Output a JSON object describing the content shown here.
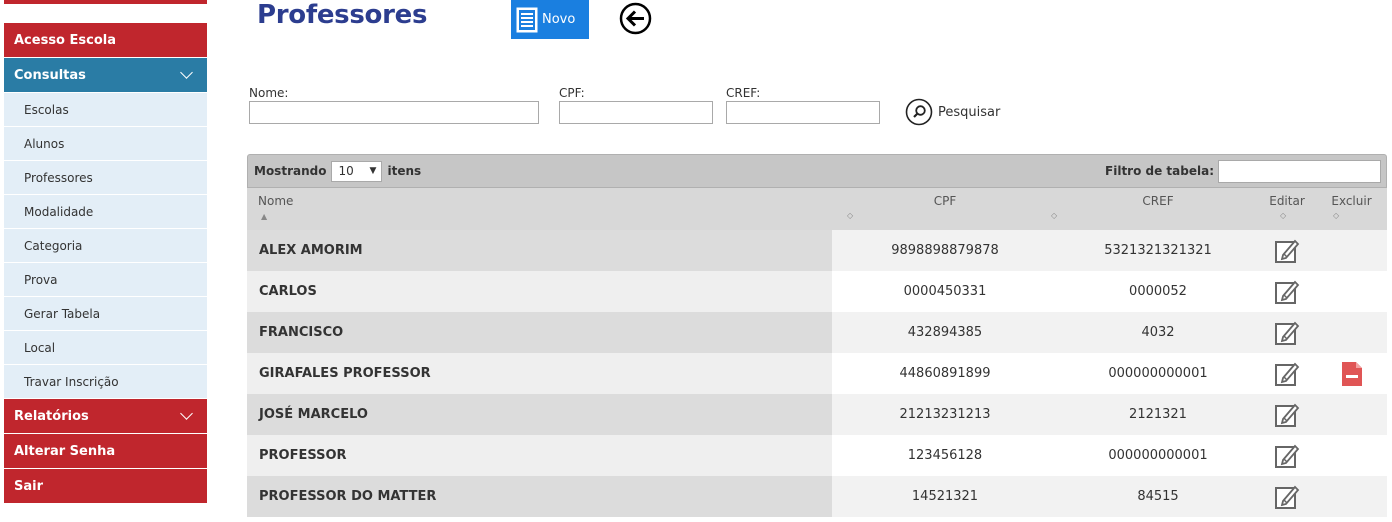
{
  "sidebar": {
    "items": [
      {
        "label": "Acesso Escola",
        "type": "red"
      },
      {
        "label": "Consultas",
        "type": "blue",
        "expanded": true
      },
      {
        "label": "Relatórios",
        "type": "red"
      },
      {
        "label": "Alterar Senha",
        "type": "red"
      },
      {
        "label": "Sair",
        "type": "red"
      }
    ],
    "consultas_sub": [
      "Escolas",
      "Alunos",
      "Professores",
      "Modalidade",
      "Categoria",
      "Prova",
      "Gerar Tabela",
      "Local",
      "Travar Inscrição"
    ]
  },
  "header": {
    "title": "Professores",
    "novo_label": "Novo",
    "back_icon": "arrow-left-circle-icon"
  },
  "filters": {
    "nome_label": "Nome:",
    "cpf_label": "CPF:",
    "cref_label": "CREF:",
    "nome_value": "",
    "cpf_value": "",
    "cref_value": "",
    "search_label": "Pesquisar"
  },
  "table": {
    "showing_label": "Mostrando",
    "page_size": "10",
    "items_label": "itens",
    "filter_label": "Filtro de tabela:",
    "filter_value": "",
    "columns": [
      "Nome",
      "CPF",
      "CREF",
      "Editar",
      "Excluir"
    ],
    "rows": [
      {
        "nome": "ALEX AMORIM",
        "cpf": "9898898879878",
        "cref": "5321321321321",
        "deletable": false
      },
      {
        "nome": "CARLOS",
        "cpf": "0000450331",
        "cref": "0000052",
        "deletable": false
      },
      {
        "nome": "FRANCISCO",
        "cpf": "432894385",
        "cref": "4032",
        "deletable": false
      },
      {
        "nome": "GIRAFALES PROFESSOR",
        "cpf": "44860891899",
        "cref": "000000000001",
        "deletable": true
      },
      {
        "nome": "JOSÉ MARCELO",
        "cpf": "21213231213",
        "cref": "2121321",
        "deletable": false
      },
      {
        "nome": "PROFESSOR",
        "cpf": "123456128",
        "cref": "000000000001",
        "deletable": false
      },
      {
        "nome": "PROFESSOR DO MATTER",
        "cpf": "14521321",
        "cref": "84515",
        "deletable": false
      }
    ]
  },
  "colors": {
    "menu_red": "#c0262d",
    "menu_blue": "#2a7ca5",
    "submenu_bg": "#e3eef7",
    "title": "#2c3d8f",
    "novo_button": "#1a7fe0",
    "delete": "#e05555"
  }
}
